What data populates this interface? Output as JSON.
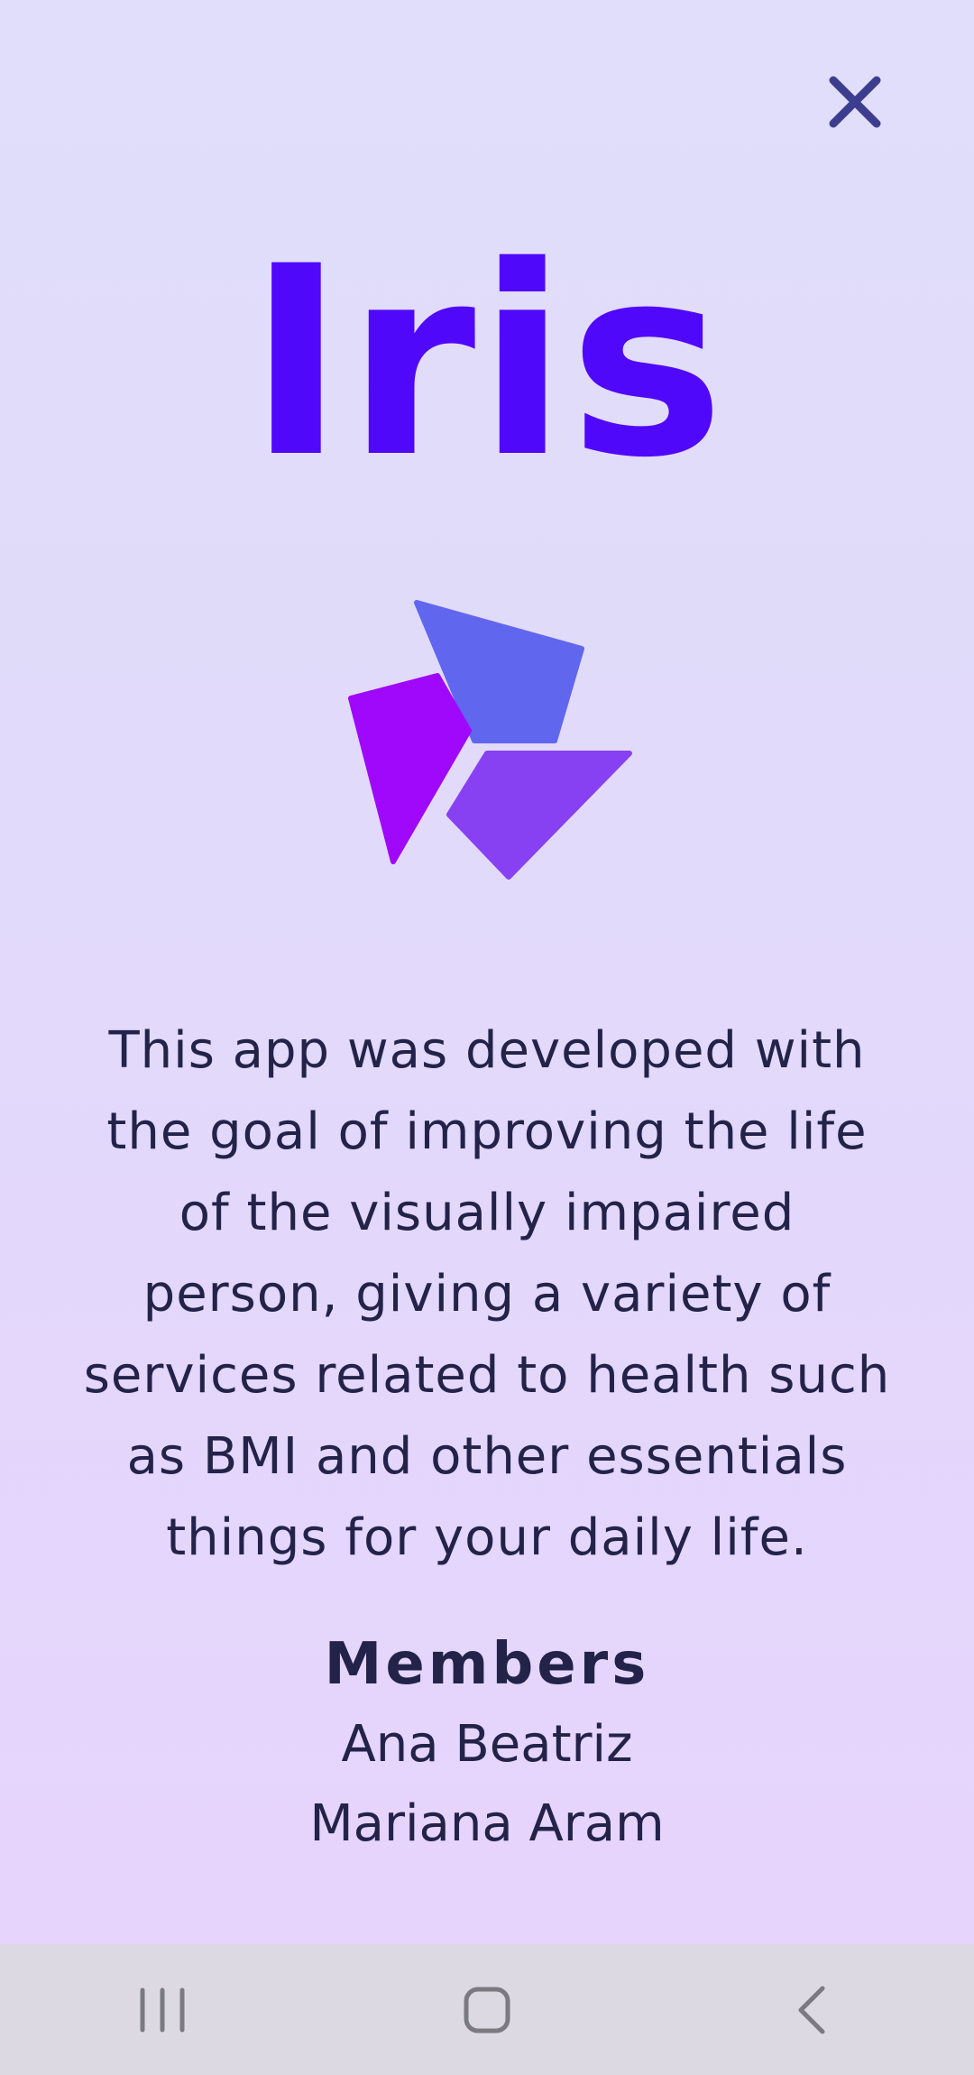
{
  "app": {
    "title": "Iris"
  },
  "header": {
    "close_icon": "close-icon"
  },
  "logo": {
    "icon": "iris-logo-icon",
    "colors": {
      "top": "#6166ef",
      "left": "#9f08fb",
      "bottom": "#8840f3"
    }
  },
  "about": {
    "description": "This app was developed with the goal of improving the life of the visually impaired person, giving a variety of services related to health such as BMI and other essentials things for your daily life."
  },
  "members": {
    "heading": "Members",
    "names": [
      "Ana Beatriz",
      "Mariana Aram"
    ]
  },
  "navbar": {
    "recents_icon": "recents-icon",
    "home_icon": "home-icon",
    "back_icon": "back-icon"
  },
  "colors": {
    "accent": "#5008fb",
    "text": "#23234a",
    "close_icon": "#3d3d8f",
    "navbar_bg": "#dcd9e2",
    "nav_icons": "#7a7a80"
  }
}
